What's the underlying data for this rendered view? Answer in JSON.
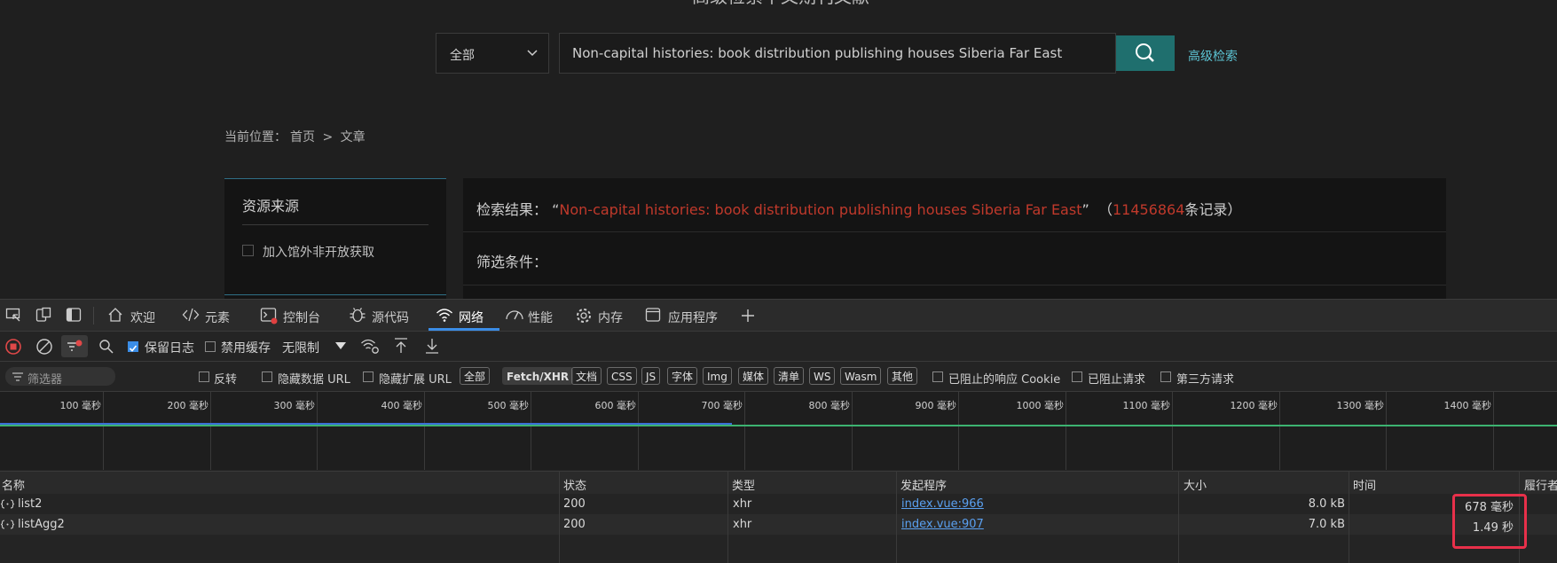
{
  "site": {
    "cut_title": "高级检索中文期刊文献",
    "scope_select": "全部",
    "query": "Non-capital histories: book distribution publishing houses Siberia Far East",
    "advanced_link": "高级检索",
    "breadcrumb": {
      "prefix": "当前位置：",
      "home": "首页",
      "sep": ">",
      "current": "文章"
    },
    "sidebar": {
      "title": "资源来源",
      "checkbox_label": "加入馆外非开放获取"
    },
    "results": {
      "label": "检索结果：",
      "open_quote": "“",
      "query": "Non-capital histories: book distribution publishing houses Siberia Far East",
      "close_quote": "”",
      "count_open": "（",
      "count": "11456864",
      "count_suffix": "条记录）",
      "filter_label": "筛选条件："
    }
  },
  "devtools": {
    "tabs": [
      {
        "label": "欢迎",
        "icon": "home-icon"
      },
      {
        "label": "元素",
        "icon": "code-icon"
      },
      {
        "label": "控制台",
        "icon": "console-icon"
      },
      {
        "label": "源代码",
        "icon": "bug-icon"
      },
      {
        "label": "网络",
        "icon": "wifi-icon"
      },
      {
        "label": "性能",
        "icon": "gauge-icon"
      },
      {
        "label": "内存",
        "icon": "gear-icon"
      },
      {
        "label": "应用程序",
        "icon": "window-icon"
      }
    ],
    "active_tab": "网络",
    "toolbar1": {
      "preserve_log": "保留日志",
      "preserve_log_checked": true,
      "disable_cache": "禁用缓存",
      "disable_cache_checked": false,
      "throttle": "无限制"
    },
    "toolbar2": {
      "filter_placeholder": "筛选器",
      "invert": "反转",
      "hide_data_url": "隐藏数据 URL",
      "hide_ext_url": "隐藏扩展 URL",
      "types": [
        "全部",
        "Fetch/XHR",
        "文档",
        "CSS",
        "JS",
        "字体",
        "Img",
        "媒体",
        "清单",
        "WS",
        "Wasm",
        "其他"
      ],
      "selected_type": "Fetch/XHR",
      "blocked_cookies": "已阻止的响应 Cookie",
      "blocked_requests": "已阻止请求",
      "third_party": "第三方请求"
    },
    "timeline_ticks": [
      "100 毫秒",
      "200 毫秒",
      "300 毫秒",
      "400 毫秒",
      "500 毫秒",
      "600 毫秒",
      "700 毫秒",
      "800 毫秒",
      "900 毫秒",
      "1000 毫秒",
      "1100 毫秒",
      "1200 毫秒",
      "1300 毫秒",
      "1400 毫秒"
    ],
    "columns": [
      "名称",
      "状态",
      "类型",
      "发起程序",
      "大小",
      "时间",
      "履行者"
    ],
    "rows": [
      {
        "name": "list2",
        "status": "200",
        "type": "xhr",
        "initiator": "index.vue:966",
        "size": "8.0 kB",
        "time": "678 毫秒"
      },
      {
        "name": "listAgg2",
        "status": "200",
        "type": "xhr",
        "initiator": "index.vue:907",
        "size": "7.0 kB",
        "time": "1.49 秒"
      }
    ],
    "colors": {
      "accent": "#3b8de6",
      "highlight": "#e8304a",
      "search_button": "#1f6f6e",
      "result_red": "#c0392b"
    }
  }
}
